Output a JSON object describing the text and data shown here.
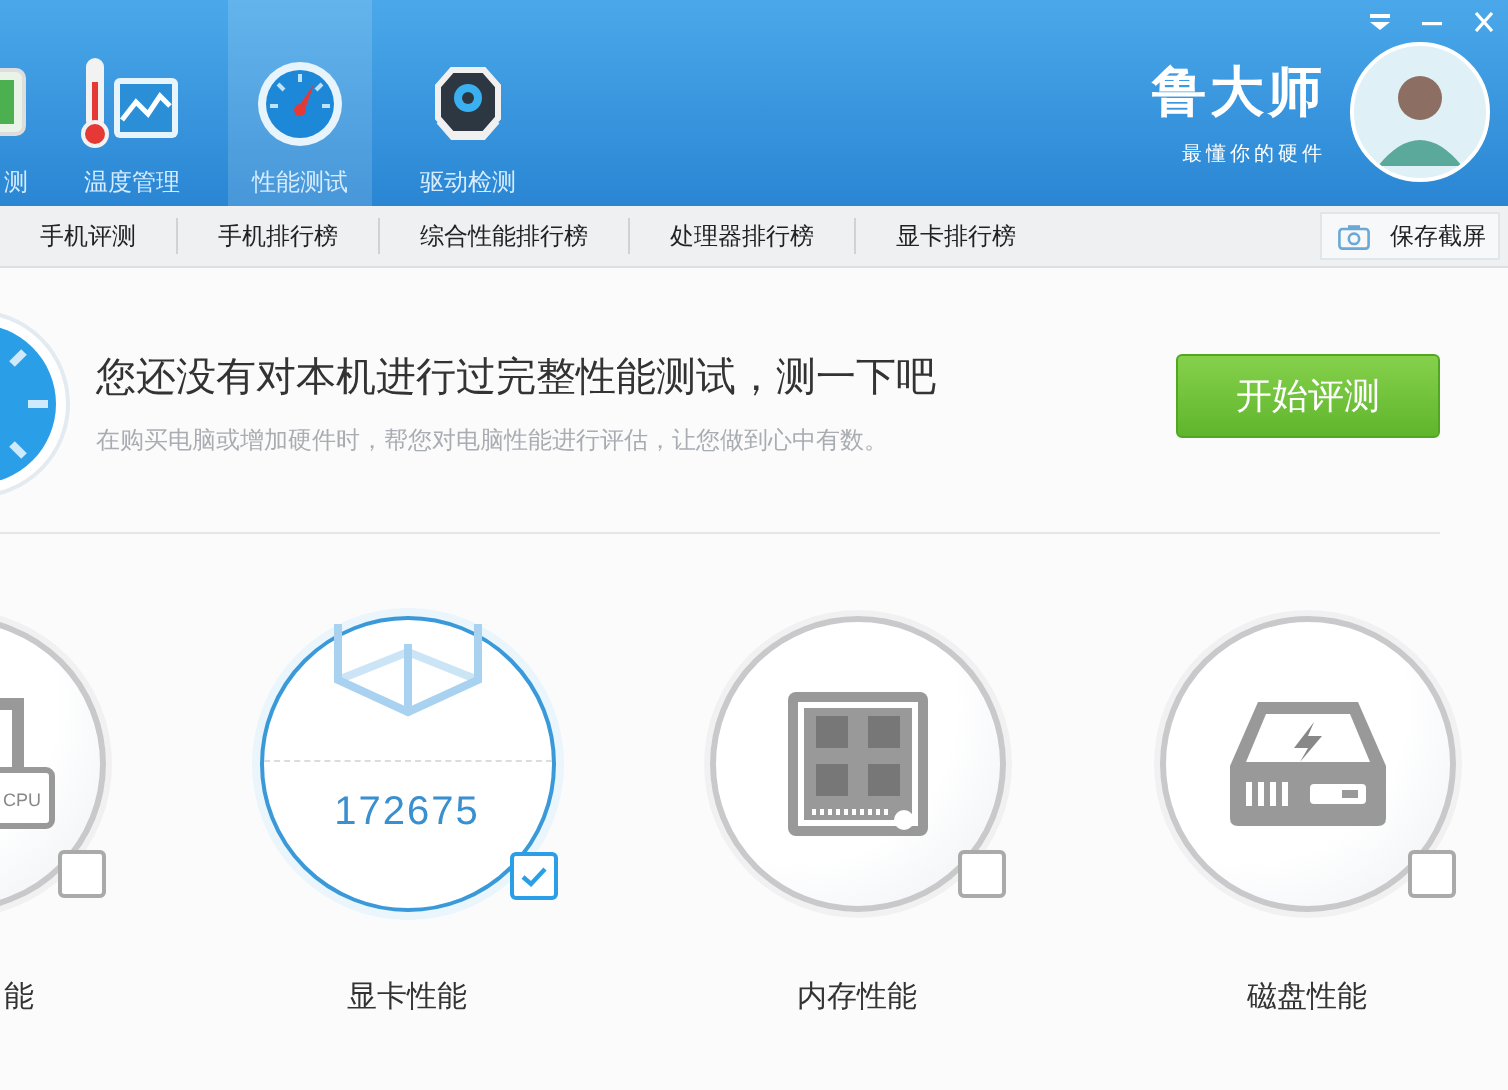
{
  "nav_tabs": [
    {
      "label": "测",
      "kind": "monitor",
      "selected": false
    },
    {
      "label": "温度管理",
      "kind": "thermometer",
      "selected": false
    },
    {
      "label": "性能测试",
      "kind": "gauge",
      "selected": true
    },
    {
      "label": "驱动检测",
      "kind": "gear",
      "selected": false
    }
  ],
  "brand": {
    "name": "鲁大师",
    "tagline": "最懂你的硬件"
  },
  "sub_nav": {
    "items": [
      "手机评测",
      "手机排行榜",
      "综合性能排行榜",
      "处理器排行榜",
      "显卡排行榜"
    ],
    "screenshot_button": "保存截屏"
  },
  "hero": {
    "headline": "您还没有对本机进行过完整性能测试，测一下吧",
    "description": "在购买电脑或增加硬件时，帮您对电脑性能进行评估，让您做到心中有数。",
    "button": "开始评测"
  },
  "cards": [
    {
      "label": "能",
      "kind": "cpu",
      "chip_text": "CPU",
      "checked": false
    },
    {
      "label": "显卡性能",
      "kind": "gpu",
      "score": "172675",
      "checked": true
    },
    {
      "label": "内存性能",
      "kind": "memory",
      "checked": false
    },
    {
      "label": "磁盘性能",
      "kind": "disk",
      "checked": false
    }
  ]
}
